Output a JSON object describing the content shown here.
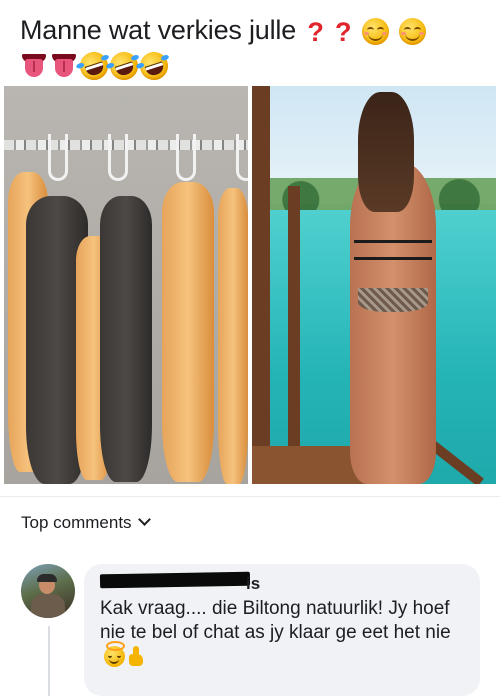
{
  "post": {
    "text": "Manne wat verkies julle",
    "emoji_line1": [
      "red-question-mark-icon",
      "red-question-mark-icon",
      "smiling-face-icon",
      "smiling-face-icon"
    ],
    "emoji_line2": [
      "tongue-face-icon",
      "tongue-face-icon",
      "rolling-laughing-face-icon",
      "rolling-laughing-face-icon",
      "rolling-laughing-face-icon"
    ],
    "question_mark": "?"
  },
  "images": [
    {
      "name": "biltong-image",
      "description_icon": "hanging-meat-photo"
    },
    {
      "name": "beach-image",
      "description_icon": "woman-on-pier-photo"
    }
  ],
  "comments_section": {
    "label": "Top comments"
  },
  "comment": {
    "author_suffix": "is",
    "text": "Kak vraag.... die Biltong natuurlik! Jy hoef nie te bel of chat as jy klaar ge eet het nie",
    "emojis": [
      "halo-face-icon",
      "thumbs-up-icon"
    ]
  },
  "colors": {
    "question_mark": "#e0262c",
    "bubble_bg": "#f0f2f5",
    "text": "#1c1e21"
  }
}
